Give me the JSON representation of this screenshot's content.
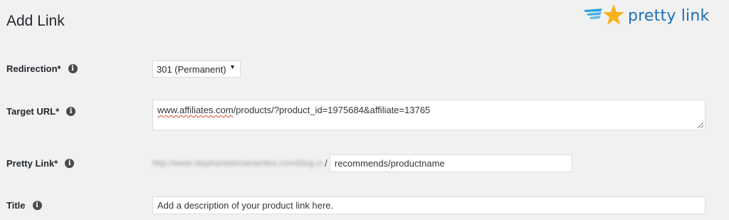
{
  "header": {
    "title": "Add Link",
    "logo_text": "pretty link",
    "logo_icon": "star-wing-icon"
  },
  "form": {
    "redirection": {
      "label": "Redirection*",
      "value": "301 (Permanent)"
    },
    "target_url": {
      "label": "Target URL*",
      "value_underlined": "www.affiliates.com",
      "value_rest": "/products/?product_id=1975684&affiliate=13765"
    },
    "pretty_link": {
      "label": "Pretty Link*",
      "domain_blurred": "http://www.stephaniebrownwrites.com/blog.com",
      "separator": "/",
      "slug": "recommends/productname"
    },
    "title": {
      "label": "Title",
      "value": "Add a description of your product link here."
    }
  },
  "icons": {
    "info": "info-icon",
    "select_caret": "caret-down-icon"
  },
  "colors": {
    "background": "#f1f1f1",
    "logo_blue": "#1e6fb5",
    "logo_star": "#f6b21b"
  }
}
